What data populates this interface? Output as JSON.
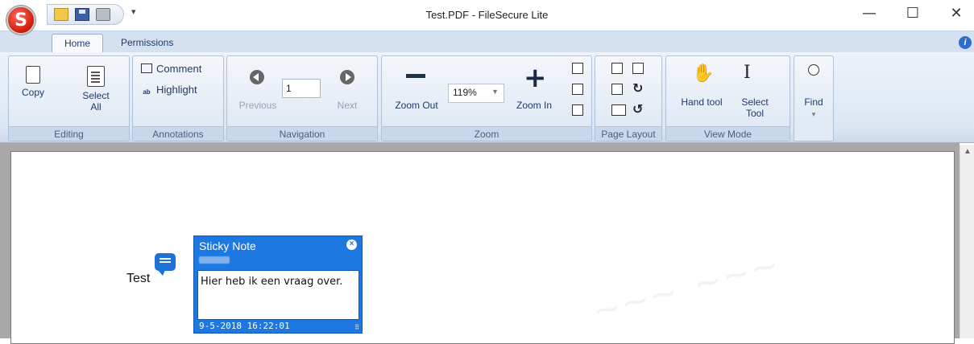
{
  "window": {
    "title": "Test.PDF - FileSecure Lite",
    "logo_letter": "S",
    "minimize_glyph": "—",
    "maximize_glyph": "☐",
    "close_glyph": "✕"
  },
  "tabs": [
    "Home",
    "Permissions"
  ],
  "ribbon": {
    "editing": {
      "label": "Editing",
      "copy": "Copy",
      "select_all_1": "Select",
      "select_all_2": "All"
    },
    "annotations": {
      "label": "Annotations",
      "comment": "Comment",
      "highlight": "Highlight"
    },
    "navigation": {
      "label": "Navigation",
      "previous": "Previous",
      "next": "Next",
      "page_value": "1"
    },
    "zoom": {
      "label": "Zoom",
      "zoom_out": "Zoom Out",
      "zoom_in": "Zoom In",
      "zoom_value": "119%"
    },
    "page_layout": {
      "label": "Page Layout"
    },
    "view_mode": {
      "label": "View Mode",
      "hand_tool": "Hand tool",
      "select_tool_1": "Select",
      "select_tool_2": "Tool"
    },
    "find": {
      "label": "Find"
    }
  },
  "document": {
    "text": "Test",
    "sticky_note": {
      "title": "Sticky Note",
      "body": "Hier heb ik een vraag over.",
      "date": "9-5-2018 16:22:01"
    }
  },
  "colors": {
    "accent": "#1e78e2",
    "ribbon_bg": "#dbe6f3",
    "logo": "#d11f0f"
  }
}
